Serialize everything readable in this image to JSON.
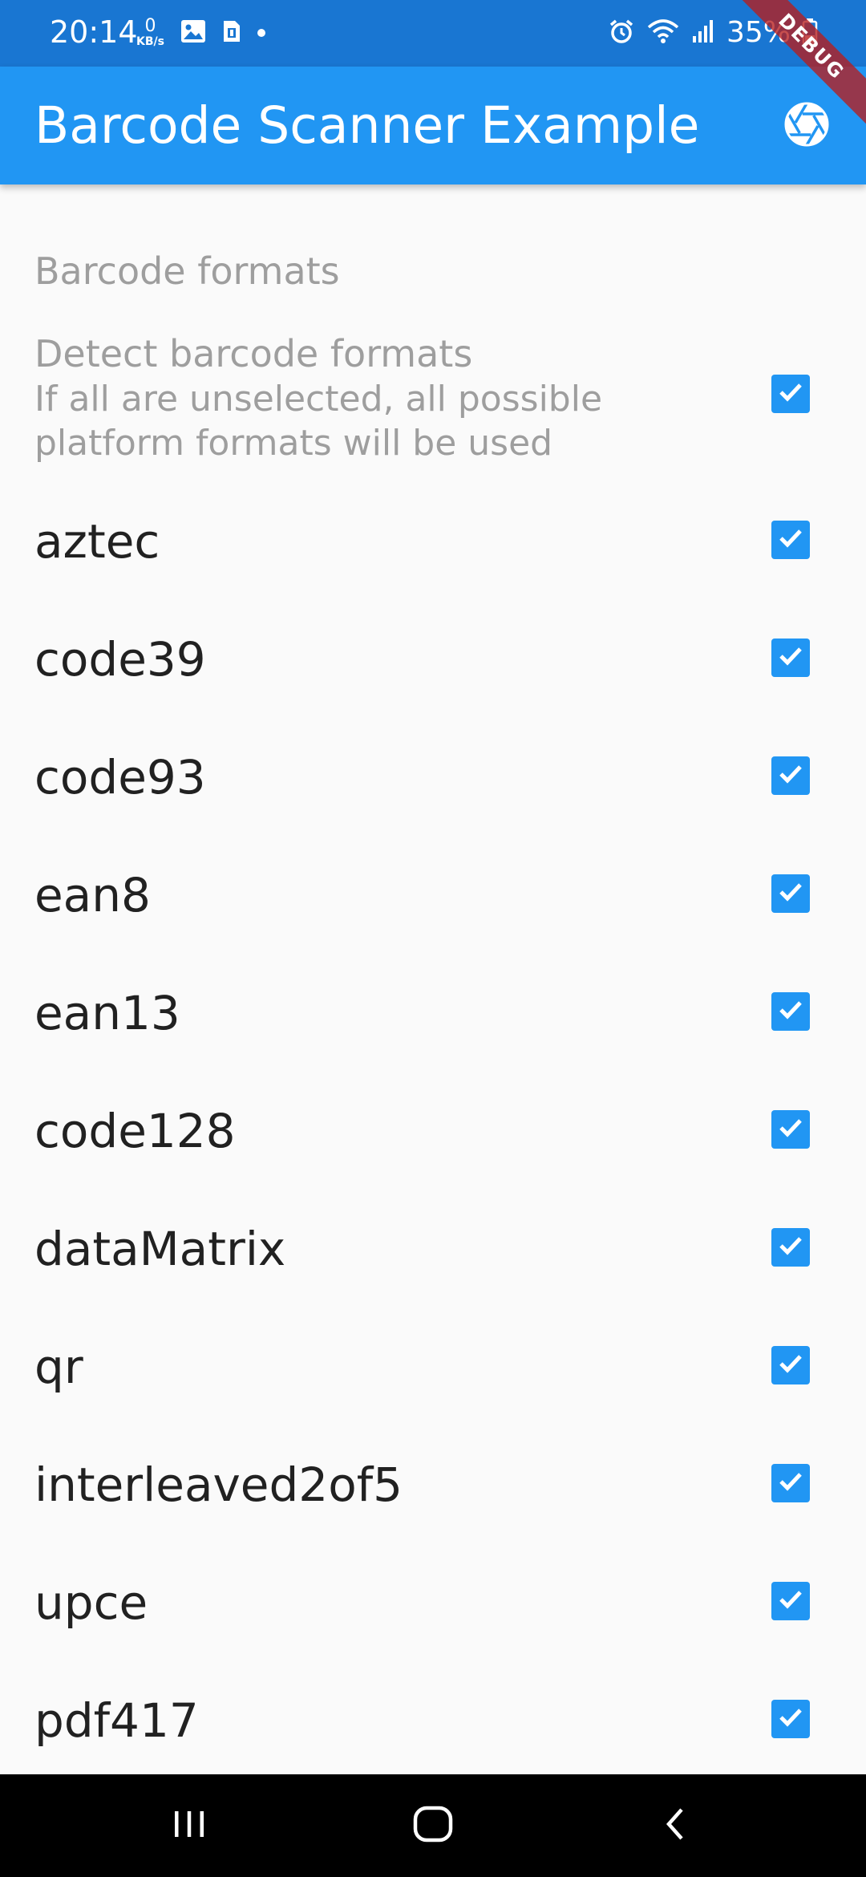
{
  "status_bar": {
    "time": "20:14",
    "data_rate_value": "0",
    "data_rate_unit": "KB/s",
    "battery_percent": "35%",
    "left_icons": [
      "image-icon",
      "sim-card-icon",
      "notification-dot-icon"
    ],
    "right_icons": [
      "alarm-icon",
      "wifi-icon",
      "signal-icon",
      "battery-icon"
    ]
  },
  "debug_banner": {
    "label": "DEBUG"
  },
  "app_bar": {
    "title": "Barcode Scanner Example",
    "action_icon": "camera-aperture-icon"
  },
  "settings": {
    "section_header": "Barcode formats",
    "detect": {
      "title": "Detect barcode formats",
      "subtitle": "If all are unselected, all possible platform formats will be used",
      "checked": true
    },
    "formats": [
      {
        "label": "aztec",
        "checked": true
      },
      {
        "label": "code39",
        "checked": true
      },
      {
        "label": "code93",
        "checked": true
      },
      {
        "label": "ean8",
        "checked": true
      },
      {
        "label": "ean13",
        "checked": true
      },
      {
        "label": "code128",
        "checked": true
      },
      {
        "label": "dataMatrix",
        "checked": true
      },
      {
        "label": "qr",
        "checked": true
      },
      {
        "label": "interleaved2of5",
        "checked": true
      },
      {
        "label": "upce",
        "checked": true
      },
      {
        "label": "pdf417",
        "checked": true
      }
    ]
  },
  "nav_bar": {
    "buttons": [
      "recent-apps-icon",
      "home-icon",
      "back-icon"
    ]
  },
  "colors": {
    "status_bar": "#1976d2",
    "app_bar": "#2196f3",
    "checkbox": "#2196f3",
    "background": "#fafafa",
    "secondary_text": "#9e9e9e",
    "primary_text": "#212121",
    "nav_bar": "#000000",
    "debug_ribbon": "#b71c1c"
  }
}
